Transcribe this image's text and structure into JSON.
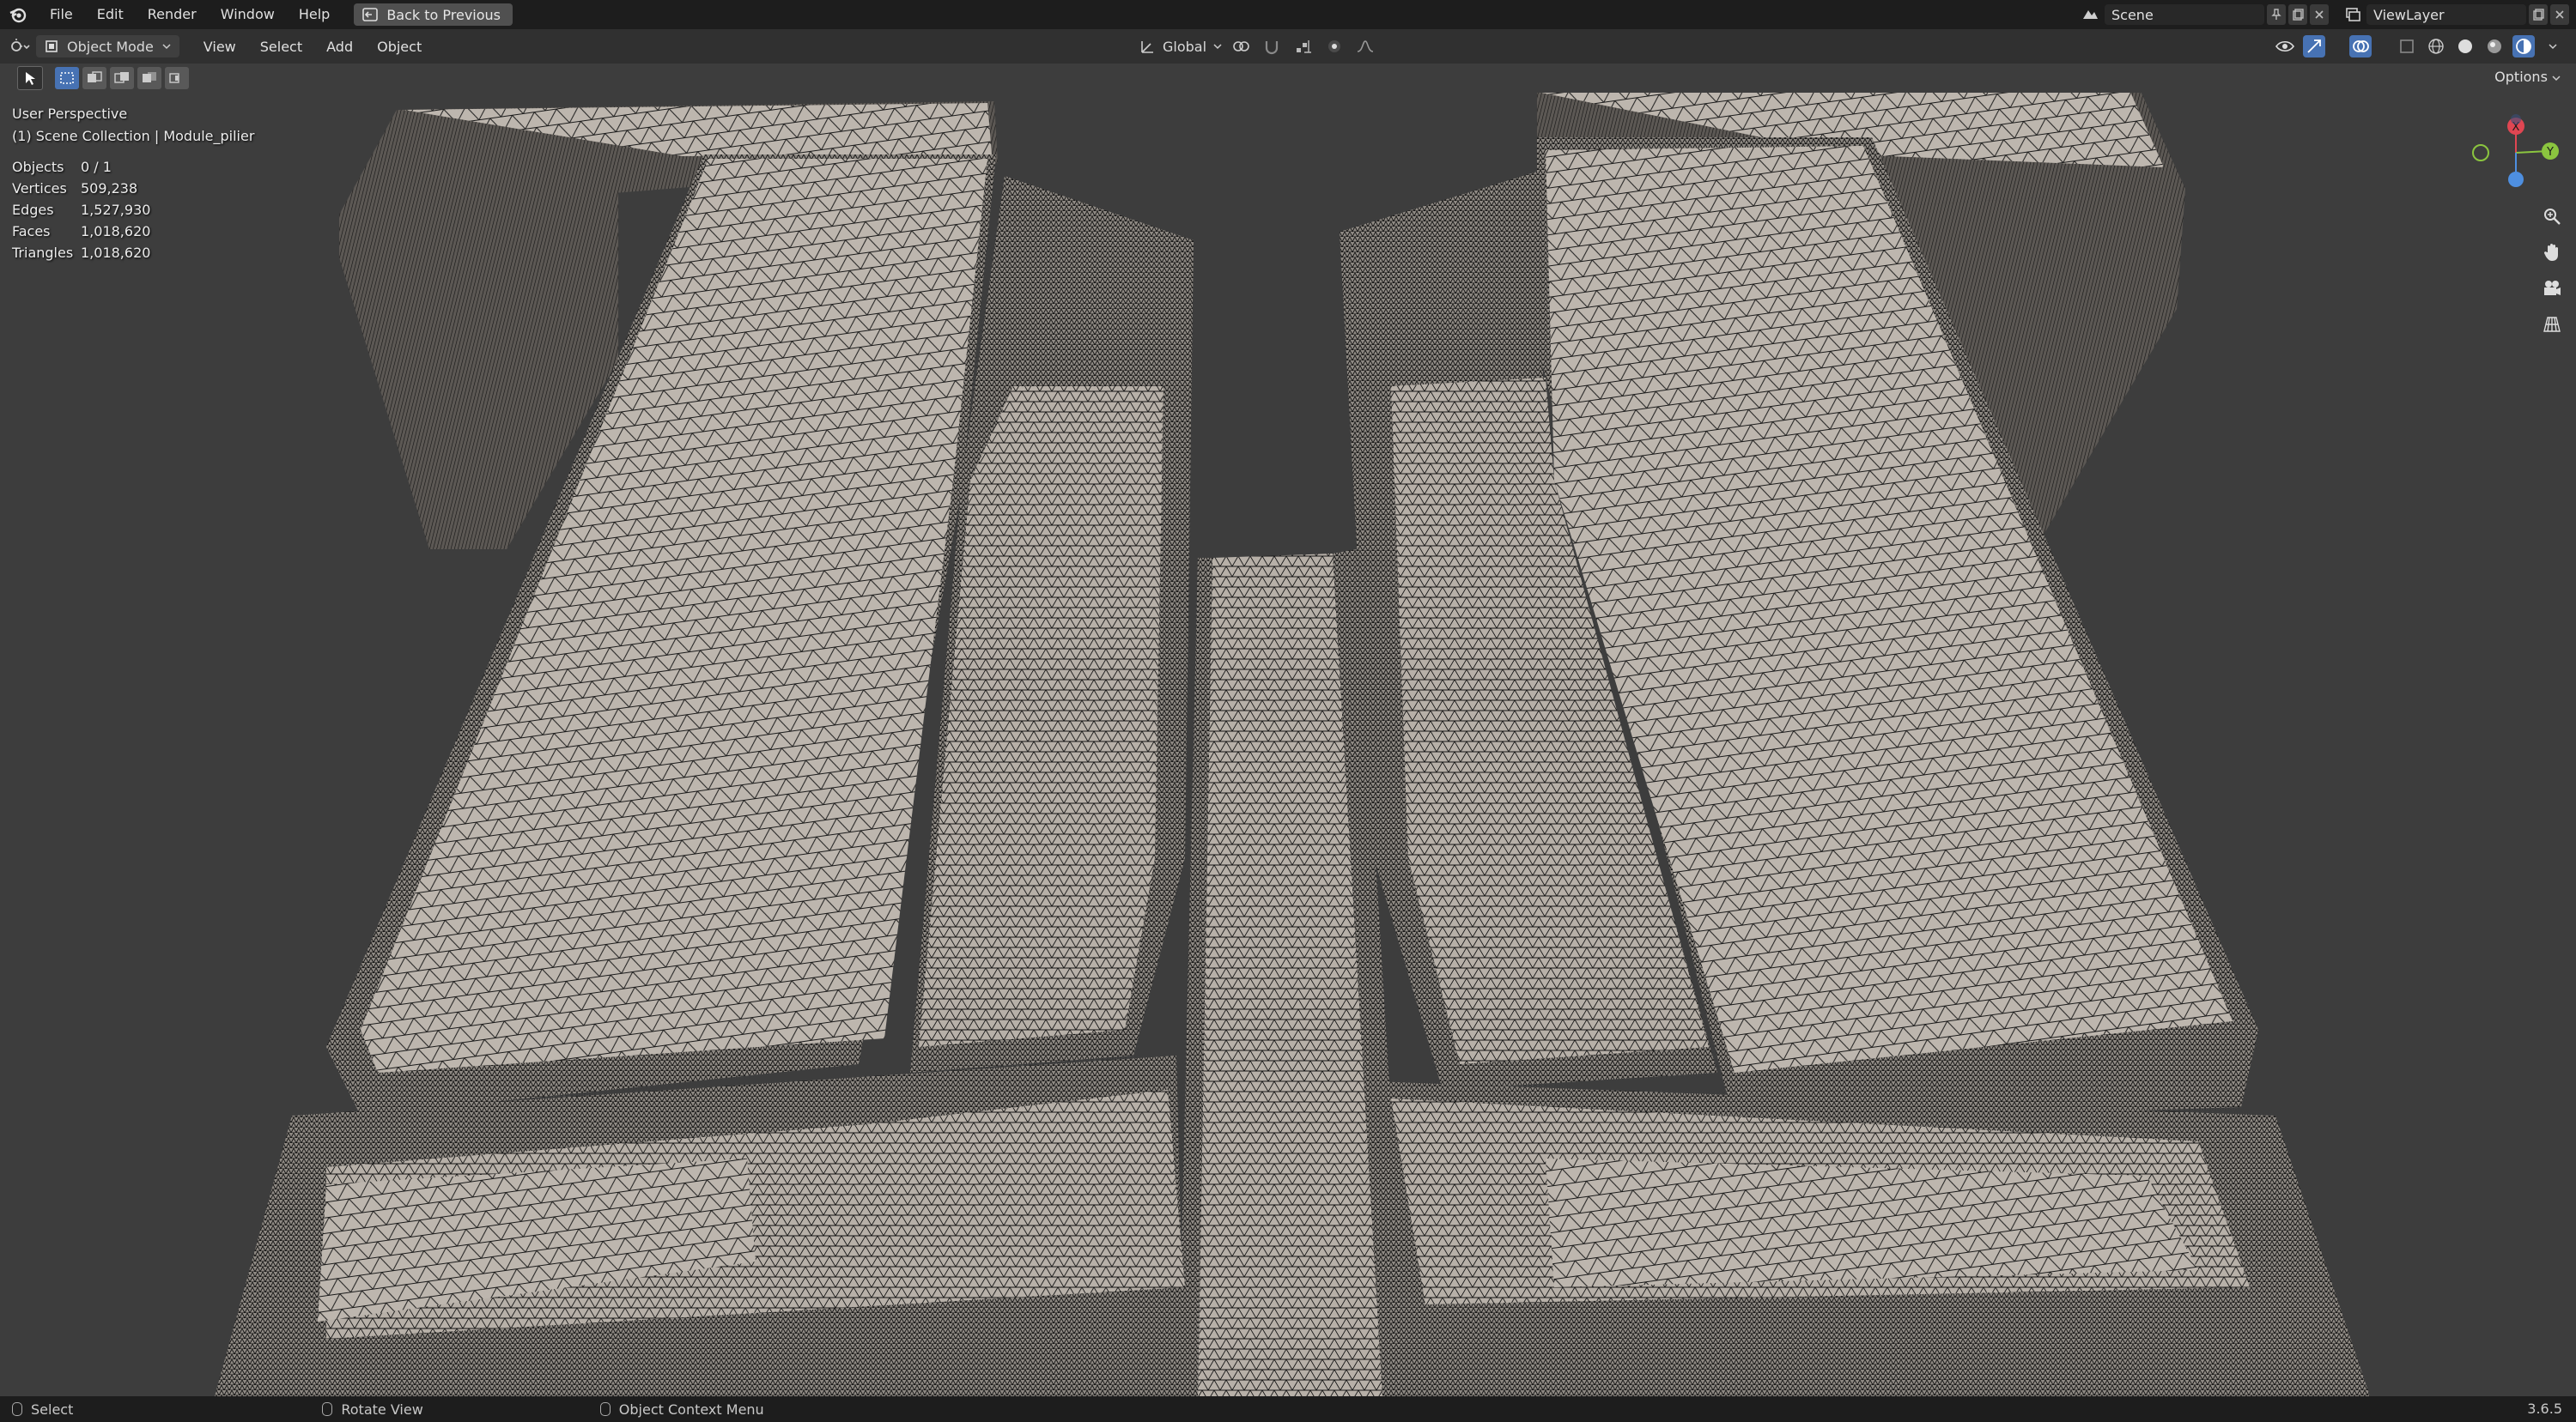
{
  "menu": [
    "File",
    "Edit",
    "Render",
    "Window",
    "Help"
  ],
  "back_button": "Back to Previous",
  "scene_field": "Scene",
  "view_layer_field": "ViewLayer",
  "viewport_header": {
    "mode": "Object Mode",
    "menus": [
      "View",
      "Select",
      "Add",
      "Object"
    ],
    "transform_orientation": "Global"
  },
  "options_label": "Options",
  "overlay": {
    "perspective": "User Perspective",
    "collection": "(1) Scene Collection | Module_pilier",
    "stats": [
      {
        "label": "Objects",
        "value": "0 / 1"
      },
      {
        "label": "Vertices",
        "value": "509,238"
      },
      {
        "label": "Edges",
        "value": "1,527,930"
      },
      {
        "label": "Faces",
        "value": "1,018,620"
      },
      {
        "label": "Triangles",
        "value": "1,018,620"
      }
    ]
  },
  "gizmo": {
    "x": "X",
    "y": "Y"
  },
  "statusbar": {
    "select": "Select",
    "rotate": "Rotate View",
    "context": "Object Context Menu",
    "version": "3.6.5"
  },
  "colors": {
    "accent": "#4772b3",
    "mesh_surface": "#bdb6ae",
    "wire": "#141414",
    "axis_x": "#e04652",
    "axis_y": "#8bc53f",
    "axis_z": "#4e8fe0"
  }
}
